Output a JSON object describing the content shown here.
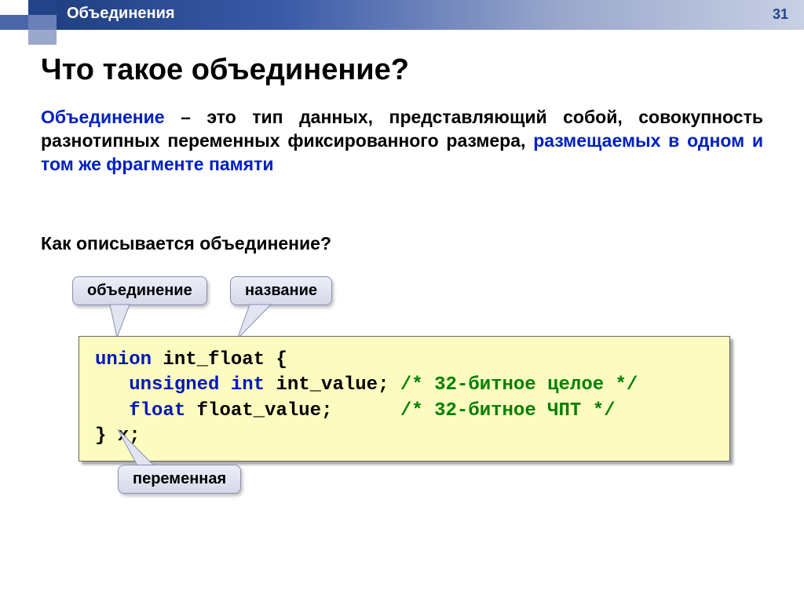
{
  "header": {
    "breadcrumb": "Объединения",
    "slide_number": "31"
  },
  "title": "Что такое объединение?",
  "definition": {
    "term": "Объединение",
    "body1": " – это тип данных, представляющий собой, совокупность разнотипных переменных фиксированного размера, ",
    "highlight": "размещаемых в одном и том же фрагменте памяти"
  },
  "subheading": "Как описывается объединение?",
  "callouts": {
    "union": "объединение",
    "name": "название",
    "variable": "переменная"
  },
  "code": {
    "l1_kw": "union",
    "l1_rest": " int_float {",
    "l2_indent": "   ",
    "l2_kw": "unsigned int",
    "l2_rest": " int_value; ",
    "l2_cm": "/* 32-битное целое */",
    "l3_indent": "   ",
    "l3_kw": "float",
    "l3_rest": " float_value;      ",
    "l3_cm": "/* 32-битное ЧПТ */",
    "l4": "} x;"
  }
}
